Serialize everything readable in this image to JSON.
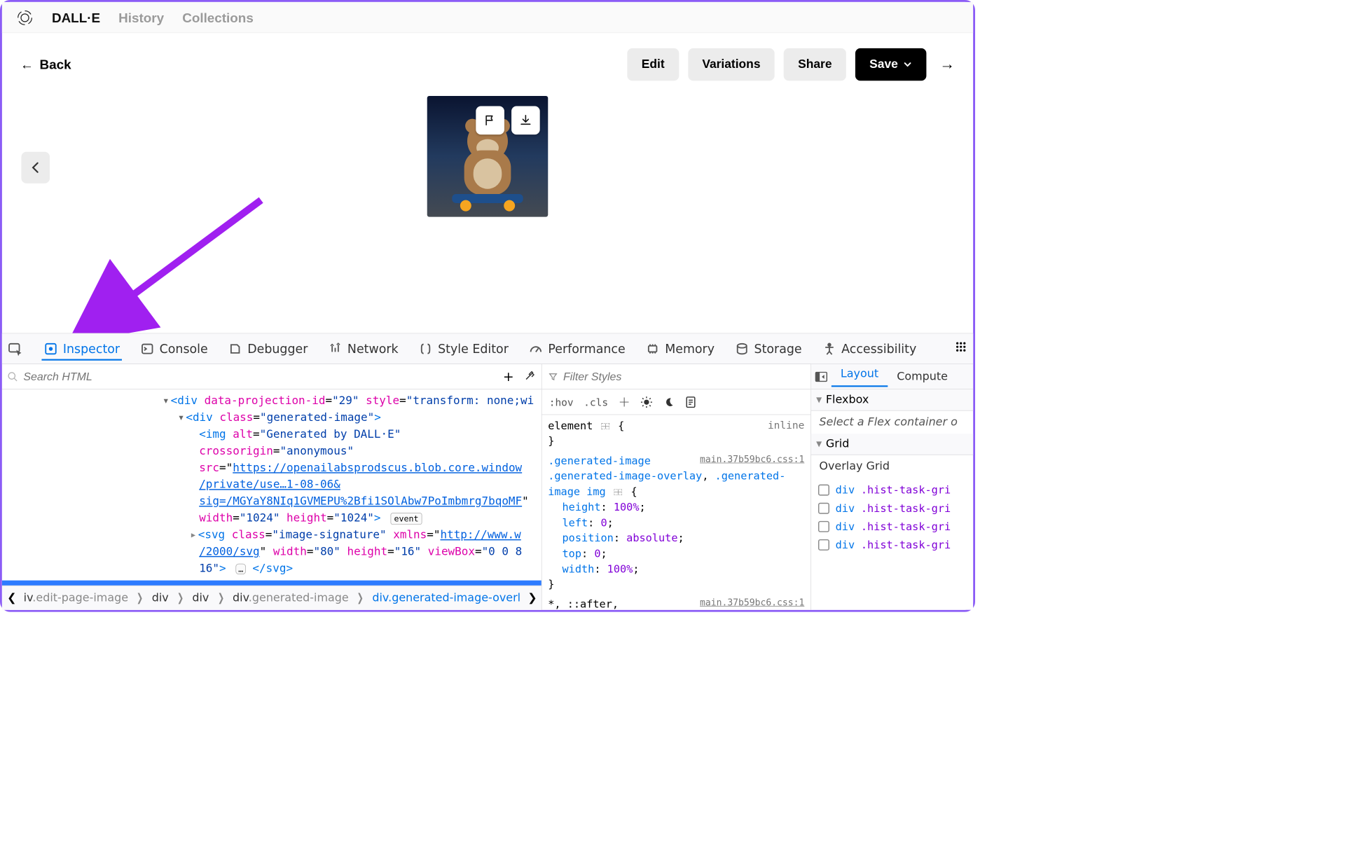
{
  "nav": {
    "brand": "DALL·E",
    "history": "History",
    "collections": "Collections"
  },
  "sub": {
    "back": "Back",
    "edit": "Edit",
    "variations": "Variations",
    "share": "Share",
    "save": "Save"
  },
  "image": {
    "flag_icon": "flag-icon",
    "download_icon": "download-icon"
  },
  "devtools": {
    "tabs": {
      "inspector": "Inspector",
      "console": "Console",
      "debugger": "Debugger",
      "network": "Network",
      "style_editor": "Style Editor",
      "performance": "Performance",
      "memory": "Memory",
      "storage": "Storage",
      "accessibility": "Accessibility"
    },
    "search_placeholder": "Search HTML",
    "add_label": "+",
    "eyedrop_label": "eyedropper",
    "tree": {
      "l1_open": "<div data-projection-id=\"29\" style=\"transform: none;",
      "l2_open": "<div class=\"generated-image\">",
      "l3_img_1": "<img alt=\"Generated by DALL·E\"",
      "l3_img_2": "crossorigin=\"anonymous\"",
      "l3_img_src_prefix": "src=\"",
      "l3_img_src_url1": "https://openailabsprodscus.blob.core.window",
      "l3_img_src_url2": "/private/use…1-08-06&",
      "l3_img_src_url3": "sig=/MGYaY8NIq1GVMEPU%2Bfi1SOlAbw7PoImbmrg7bqoMF",
      "l3_img_wh": "width=\"1024\" height=\"1024\">",
      "event_badge": "event",
      "l4_svg_1": "<svg class=\"image-signature\" xmlns=\"",
      "l4_svg_url": "http://www.w",
      "l4_svg_2": "/2000/svg\" width=\"80\" height=\"16\" viewBox=\"0 0 8",
      "l4_svg_3": "16\">",
      "l4_svg_close": "</svg>",
      "ellipsis_badge": "…"
    },
    "styles": {
      "filter_placeholder": "Filter Styles",
      "hov": ":hov",
      "cls": ".cls",
      "element_label": "element",
      "inline_label": "inline",
      "rule_selector_1": ".generated-image",
      "rule_selector_2": ".generated-image-overlay",
      "rule_selector_3": ".generated-image img",
      "source1": "main.37b59bc6.css:1",
      "prop_height": "height",
      "val_height": "100%",
      "prop_left": "left",
      "val_left": "0",
      "prop_position": "position",
      "val_position": "absolute",
      "prop_top": "top",
      "val_top": "0",
      "prop_width": "width",
      "val_width": "100%",
      "after_rule": "*, ::after,",
      "source2": "main.37b59bc6.css:1"
    },
    "layout": {
      "tab_layout": "Layout",
      "tab_computed": "Compute",
      "flexbox_h": "Flexbox",
      "flexbox_msg": "Select a Flex container o",
      "grid_h": "Grid",
      "overlay_h": "Overlay Grid",
      "grid_item_tag": "div",
      "grid_item_cls": ".hist-task-gri"
    },
    "crumbs": {
      "c1_tag": "iv",
      "c1_cls": ".edit-page-image",
      "c2": "div",
      "c3": "div",
      "c4_tag": "div",
      "c4_cls": ".generated-image",
      "c5_tag": "div",
      "c5_cls": ".generated-image-overl"
    }
  }
}
